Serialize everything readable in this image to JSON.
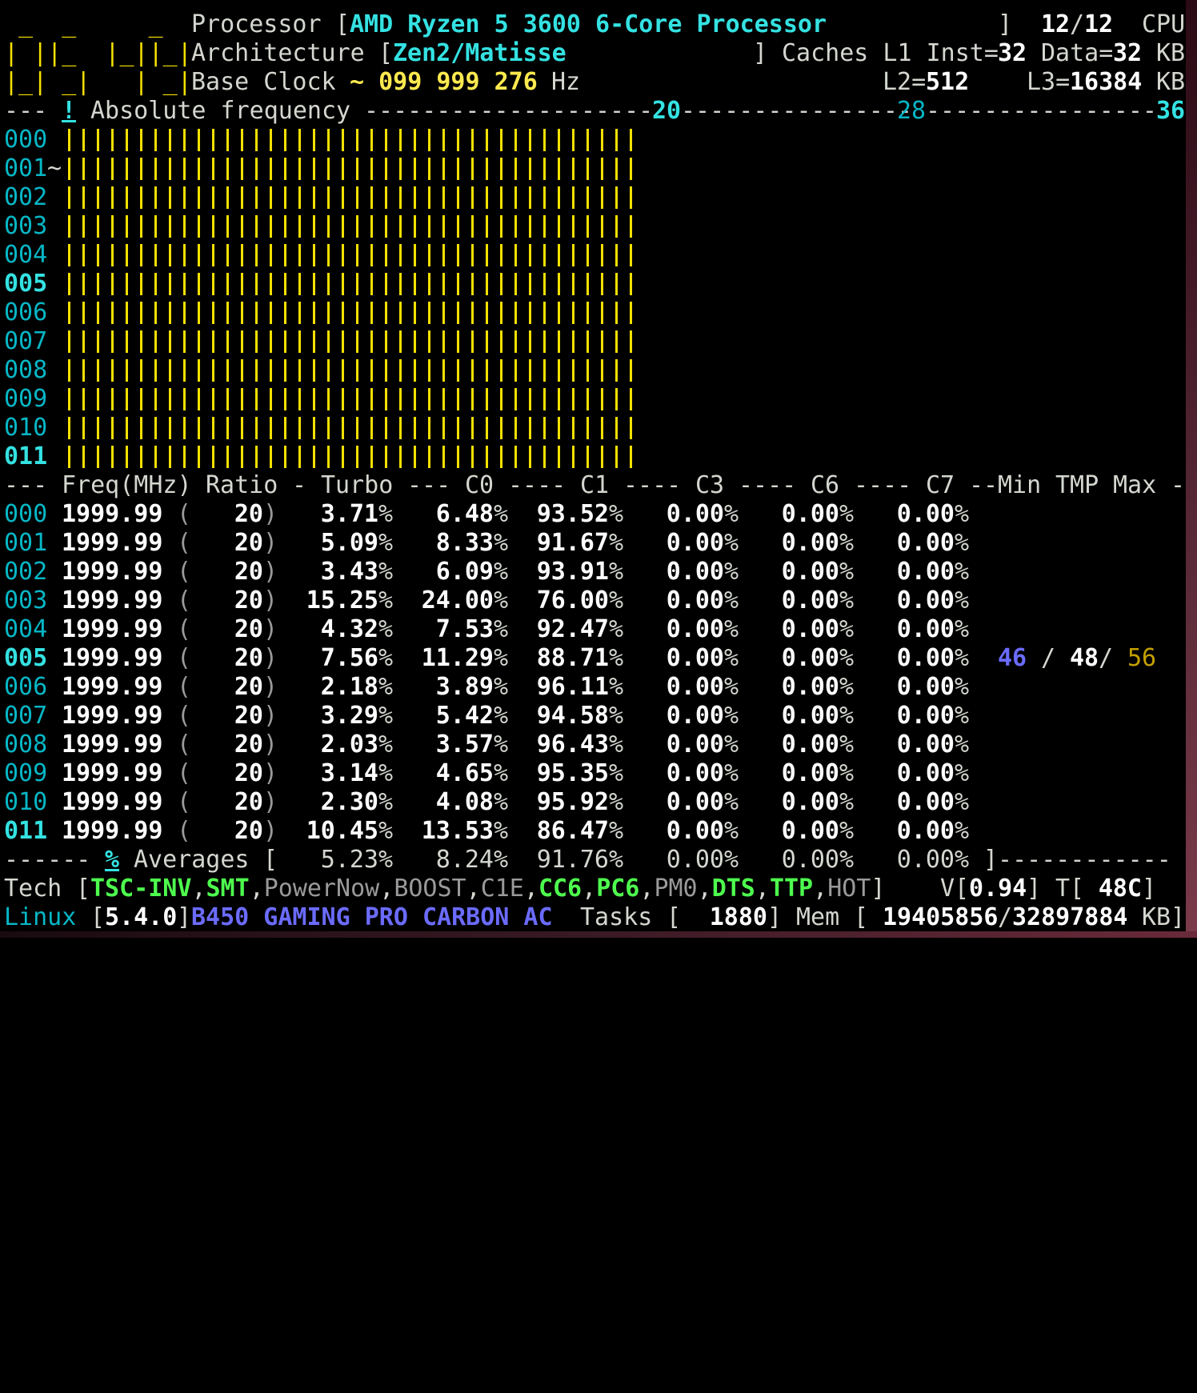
{
  "logo": [
    " _  _     _",
    "| ||_  |_||_|",
    "|_| _|   | _|"
  ],
  "header": {
    "processor_label": "Processor",
    "processor_name": "AMD Ryzen 5 3600 6-Core Processor",
    "cpu_count": "12",
    "cpu_total": "12",
    "cpu_label": "CPU",
    "architecture_label": "Architecture",
    "architecture": "Zen2/Matisse",
    "caches_label": "Caches L1 Inst=",
    "l1_inst": "32",
    "data_label": "Data=",
    "l1_data": "32",
    "kb": "KB",
    "base_clock_label": "Base Clock",
    "base_clock_value": "~ 099 999 276",
    "hz": "Hz",
    "l2_label": "L2=",
    "l2": "512",
    "l3_label": "L3=",
    "l3": "16384"
  },
  "freq_header": {
    "label": "Absolute frequency",
    "bang": "!",
    "tick_20": "20",
    "tick_28": "28",
    "tick_36": "36"
  },
  "frequency_bars": [
    {
      "core": "000",
      "mark": "",
      "ratio": 20
    },
    {
      "core": "001",
      "mark": "~",
      "ratio": 20
    },
    {
      "core": "002",
      "mark": "",
      "ratio": 20
    },
    {
      "core": "003",
      "mark": "",
      "ratio": 20
    },
    {
      "core": "004",
      "mark": "",
      "ratio": 20
    },
    {
      "core": "005",
      "mark": "",
      "ratio": 20
    },
    {
      "core": "006",
      "mark": "",
      "ratio": 20
    },
    {
      "core": "007",
      "mark": "",
      "ratio": 20
    },
    {
      "core": "008",
      "mark": "",
      "ratio": 20
    },
    {
      "core": "009",
      "mark": "",
      "ratio": 20
    },
    {
      "core": "010",
      "mark": "",
      "ratio": 20
    },
    {
      "core": "011",
      "mark": "",
      "ratio": 20
    }
  ],
  "table_header": {
    "freq": "Freq(MHz)",
    "ratio": "Ratio",
    "turbo": "Turbo",
    "c0": "C0",
    "c1": "C1",
    "c3": "C3",
    "c6": "C6",
    "c7": "C7",
    "min": "Min",
    "tmp": "TMP",
    "max": "Max"
  },
  "rows": [
    {
      "core": "000",
      "freq": "1999.99",
      "ratio": "20",
      "turbo": "3.71",
      "c0": "6.48",
      "c1": "93.52",
      "c3": "0.00",
      "c6": "0.00",
      "c7": "0.00"
    },
    {
      "core": "001",
      "freq": "1999.99",
      "ratio": "20",
      "turbo": "5.09",
      "c0": "8.33",
      "c1": "91.67",
      "c3": "0.00",
      "c6": "0.00",
      "c7": "0.00"
    },
    {
      "core": "002",
      "freq": "1999.99",
      "ratio": "20",
      "turbo": "3.43",
      "c0": "6.09",
      "c1": "93.91",
      "c3": "0.00",
      "c6": "0.00",
      "c7": "0.00"
    },
    {
      "core": "003",
      "freq": "1999.99",
      "ratio": "20",
      "turbo": "15.25",
      "c0": "24.00",
      "c1": "76.00",
      "c3": "0.00",
      "c6": "0.00",
      "c7": "0.00"
    },
    {
      "core": "004",
      "freq": "1999.99",
      "ratio": "20",
      "turbo": "4.32",
      "c0": "7.53",
      "c1": "92.47",
      "c3": "0.00",
      "c6": "0.00",
      "c7": "0.00"
    },
    {
      "core": "005",
      "freq": "1999.99",
      "ratio": "20",
      "turbo": "7.56",
      "c0": "11.29",
      "c1": "88.71",
      "c3": "0.00",
      "c6": "0.00",
      "c7": "0.00"
    },
    {
      "core": "006",
      "freq": "1999.99",
      "ratio": "20",
      "turbo": "2.18",
      "c0": "3.89",
      "c1": "96.11",
      "c3": "0.00",
      "c6": "0.00",
      "c7": "0.00"
    },
    {
      "core": "007",
      "freq": "1999.99",
      "ratio": "20",
      "turbo": "3.29",
      "c0": "5.42",
      "c1": "94.58",
      "c3": "0.00",
      "c6": "0.00",
      "c7": "0.00"
    },
    {
      "core": "008",
      "freq": "1999.99",
      "ratio": "20",
      "turbo": "2.03",
      "c0": "3.57",
      "c1": "96.43",
      "c3": "0.00",
      "c6": "0.00",
      "c7": "0.00"
    },
    {
      "core": "009",
      "freq": "1999.99",
      "ratio": "20",
      "turbo": "3.14",
      "c0": "4.65",
      "c1": "95.35",
      "c3": "0.00",
      "c6": "0.00",
      "c7": "0.00"
    },
    {
      "core": "010",
      "freq": "1999.99",
      "ratio": "20",
      "turbo": "2.30",
      "c0": "4.08",
      "c1": "95.92",
      "c3": "0.00",
      "c6": "0.00",
      "c7": "0.00"
    },
    {
      "core": "011",
      "freq": "1999.99",
      "ratio": "20",
      "turbo": "10.45",
      "c0": "13.53",
      "c1": "86.47",
      "c3": "0.00",
      "c6": "0.00",
      "c7": "0.00"
    }
  ],
  "temperature": {
    "min": "46",
    "current": "48",
    "max": "56"
  },
  "averages": {
    "pct": "%",
    "label": "Averages",
    "turbo": "5.23",
    "c0": "8.24",
    "c1": "91.76",
    "c3": "0.00",
    "c6": "0.00",
    "c7": "0.00"
  },
  "tech": {
    "label": "Tech",
    "flags": [
      {
        "name": "TSC-INV",
        "on": true
      },
      {
        "name": "SMT",
        "on": true
      },
      {
        "name": "PowerNow",
        "on": false
      },
      {
        "name": "BOOST",
        "on": false
      },
      {
        "name": "C1E",
        "on": false
      },
      {
        "name": "CC6",
        "on": true
      },
      {
        "name": "PC6",
        "on": true
      },
      {
        "name": "PM0",
        "on": false
      },
      {
        "name": "DTS",
        "on": true
      },
      {
        "name": "TTP",
        "on": true
      },
      {
        "name": "HOT",
        "on": false
      }
    ],
    "voltage_label": "V",
    "voltage": "0.94",
    "temp_label": "T",
    "temp": "48C"
  },
  "system": {
    "os": "Linux",
    "kernel": "5.4.0",
    "board": "B450 GAMING PRO CARBON AC",
    "tasks_label": "Tasks",
    "tasks": "1880",
    "mem_label": "Mem",
    "mem_used": "19405856",
    "mem_total": "32897884",
    "mem_unit": "KB"
  }
}
